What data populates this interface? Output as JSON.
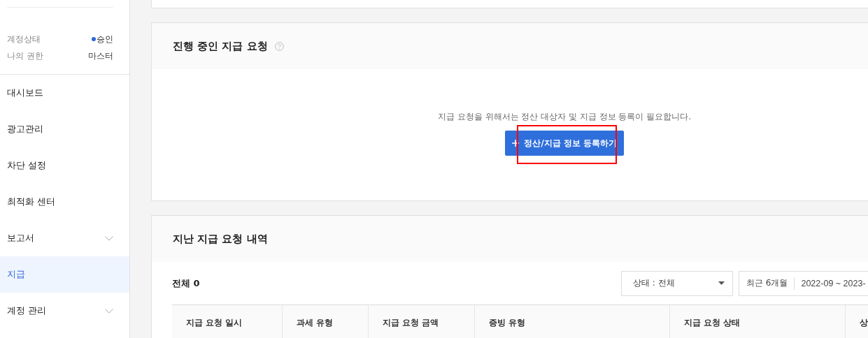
{
  "sidebar": {
    "account": [
      {
        "label": "계정상태",
        "value": "승인",
        "color": "#2f66dc"
      },
      {
        "label": "나의 권한",
        "value": "마스터"
      }
    ],
    "items": [
      {
        "label": "대시보드",
        "selected": false,
        "expandable": false
      },
      {
        "label": "광고관리",
        "selected": false,
        "expandable": false
      },
      {
        "label": "차단 설정",
        "selected": false,
        "expandable": false
      },
      {
        "label": "최적화 센터",
        "selected": false,
        "expandable": false
      },
      {
        "label": "보고서",
        "selected": false,
        "expandable": true
      },
      {
        "label": "지급",
        "selected": true,
        "expandable": false
      },
      {
        "label": "계정 관리",
        "selected": false,
        "expandable": true
      }
    ]
  },
  "pending": {
    "title": "진행 중인 지급 요청",
    "message": "지급 요청을 위해서는 정산 대상자 및 지급 정보 등록이 필요합니다.",
    "button": "정산/지급 정보 등록하기",
    "highlighted": true
  },
  "history": {
    "title": "지난 지급 요청 내역",
    "total": "전체 0",
    "status_filter": "상태 : 전체",
    "period": "최근 6개월",
    "date_range": "2022-09 ~ 2023-",
    "columns": [
      "지급 요청 일시",
      "과세 유형",
      "지급 요청 금액",
      "증빙 유형",
      "지급 요청 상태",
      "상"
    ]
  }
}
